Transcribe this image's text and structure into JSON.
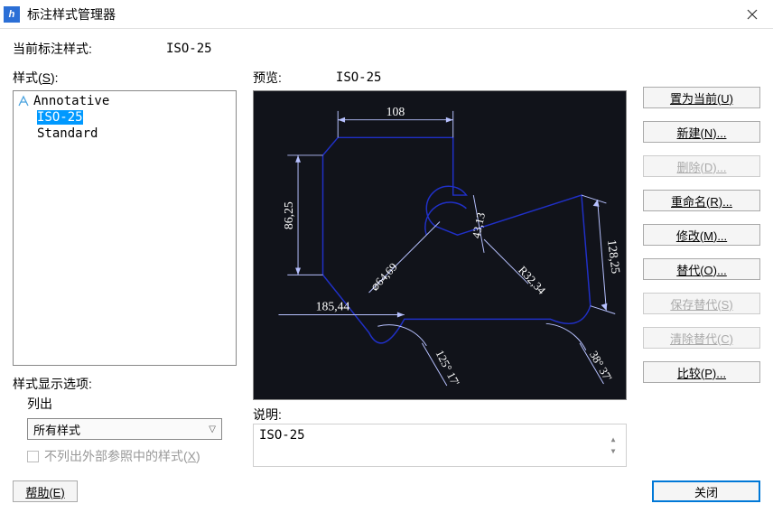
{
  "window": {
    "title": "标注样式管理器",
    "icon_glyph": "h"
  },
  "current_style": {
    "label": "当前标注样式:",
    "value": "ISO-25"
  },
  "styles_section": {
    "label_pre": "样式(",
    "label_key": "S",
    "label_post": "):",
    "items": [
      {
        "text": "Annotative",
        "selected": false,
        "has_icon": true
      },
      {
        "text": "ISO-25",
        "selected": true,
        "has_icon": false
      },
      {
        "text": "Standard",
        "selected": false,
        "has_icon": false
      }
    ]
  },
  "preview": {
    "label": "预览:",
    "style_name": "ISO-25",
    "dimensions": {
      "top": "108",
      "left_v": "86,25",
      "right_v": "128,25",
      "r_inner": "43,13",
      "r_fillet": "R32,34",
      "diam": "⌀64,69",
      "h_bottom": "185,44",
      "angle_left": "125° 17'",
      "angle_right": "38° 37'"
    }
  },
  "description": {
    "label": "说明:",
    "text": "ISO-25"
  },
  "display_options": {
    "title": "样式显示选项:",
    "subtitle": "列出",
    "dropdown_value": "所有样式",
    "checkbox_label_pre": "不列出外部参照中的样式(",
    "checkbox_label_key": "X",
    "checkbox_label_post": ")"
  },
  "buttons": {
    "set_current": "置为当前(U)",
    "new": "新建(N)...",
    "delete": "删除(D)...",
    "rename": "重命名(R)...",
    "modify": "修改(M)...",
    "override": "替代(O)...",
    "save_override": "保存替代(S)",
    "clear_override": "清除替代(C)",
    "compare": "比较(P)...",
    "help": "帮助(E)",
    "close": "关闭"
  }
}
